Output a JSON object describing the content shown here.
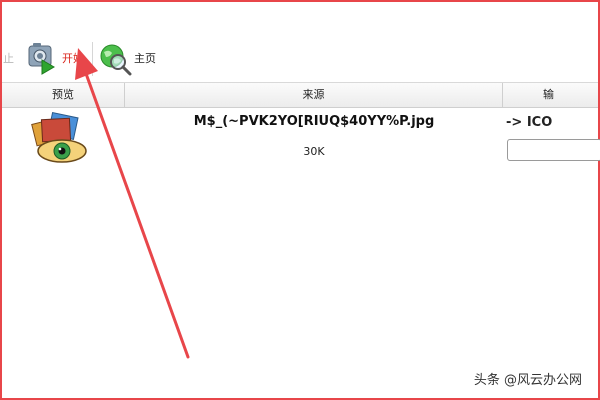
{
  "toolbar": {
    "stop_label": "止",
    "start_label": "开始",
    "home_label": "主页"
  },
  "table": {
    "headers": [
      "预览",
      "来源",
      "输"
    ]
  },
  "row": {
    "filename": "M$_(~PVK2YO[RIUQ$40YY%P.jpg",
    "size": "30K",
    "format": "-> ICO",
    "output_value": ""
  },
  "watermark": {
    "text": "头条 @风云办公网"
  },
  "colors": {
    "frame": "#e8464a",
    "arrow": "#e8464a",
    "start_text": "#d9261c"
  },
  "icons": {
    "start": "converter-start-icon",
    "home": "globe-magnifier-icon",
    "preview": "image-eye-thumbnail"
  }
}
